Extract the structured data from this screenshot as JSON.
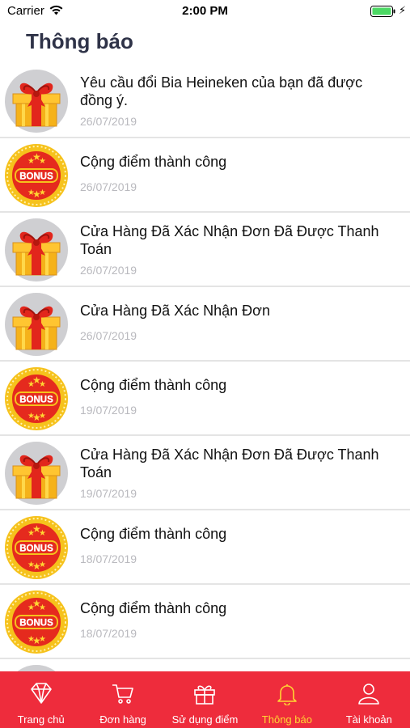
{
  "status_bar": {
    "carrier": "Carrier",
    "time": "2:00 PM"
  },
  "header": {
    "title": "Thông báo"
  },
  "notifications": [
    {
      "icon": "gift-icon",
      "lines": [
        "Yêu cầu đổi Bia Heineken của bạn đã được",
        "đồng ý."
      ],
      "date": "26/07/2019"
    },
    {
      "icon": "bonus-icon",
      "lines": [
        "Cộng điểm thành công"
      ],
      "date": "26/07/2019"
    },
    {
      "icon": "gift-icon",
      "lines": [
        "Cửa Hàng Đã Xác Nhận Đơn Đã Được Thanh",
        "Toán"
      ],
      "date": "26/07/2019"
    },
    {
      "icon": "gift-icon",
      "lines": [
        "Cửa Hàng Đã Xác Nhận Đơn"
      ],
      "date": "26/07/2019"
    },
    {
      "icon": "bonus-icon",
      "lines": [
        "Cộng điểm thành công"
      ],
      "date": "19/07/2019"
    },
    {
      "icon": "gift-icon",
      "lines": [
        "Cửa Hàng Đã Xác Nhận Đơn Đã Được Thanh",
        "Toán"
      ],
      "date": "19/07/2019"
    },
    {
      "icon": "bonus-icon",
      "lines": [
        "Cộng điểm thành công"
      ],
      "date": "18/07/2019"
    },
    {
      "icon": "bonus-icon",
      "lines": [
        "Cộng điểm thành công"
      ],
      "date": "18/07/2019"
    }
  ],
  "bonus_badge_text": "BONUS",
  "tab_bar": {
    "tabs": [
      {
        "label": "Trang chủ",
        "icon": "diamond-icon",
        "active": false
      },
      {
        "label": "Đơn hàng",
        "icon": "cart-icon",
        "active": false
      },
      {
        "label": "Sử dụng điểm",
        "icon": "gift-box-icon",
        "active": false
      },
      {
        "label": "Thông báo",
        "icon": "bell-icon",
        "active": true
      },
      {
        "label": "Tài khoản",
        "icon": "user-icon",
        "active": false
      }
    ]
  },
  "colors": {
    "tab_bar_bg": "#ee2c3c",
    "active_tab": "#ffd633",
    "title": "#2f3348",
    "date": "#b9b9be"
  }
}
